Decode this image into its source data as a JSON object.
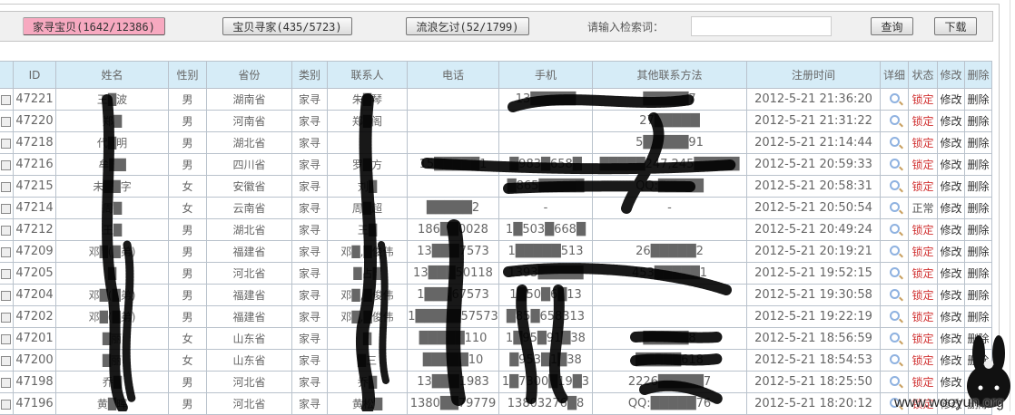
{
  "toolbar": {
    "tabs": [
      {
        "label": "家寻宝贝(1642/12386)",
        "active": true
      },
      {
        "label": "宝贝寻家(435/5723)",
        "active": false
      },
      {
        "label": "流浪乞讨(52/1799)",
        "active": false
      }
    ],
    "search_label": "请输入检索词：",
    "search_value": "",
    "query_label": "查询",
    "download_label": "下载"
  },
  "table": {
    "headers": [
      "ID",
      "姓名",
      "性别",
      "省份",
      "类别",
      "联系人",
      "电话",
      "手机",
      "其他联系方法",
      "注册时间",
      "详细",
      "状态",
      "修改",
      "删除"
    ],
    "rows": [
      {
        "id": "47221",
        "name": "王█波",
        "gender": "男",
        "province": "湖南省",
        "type": "家寻",
        "contact": "朱█琴",
        "phone": "",
        "mobile": "13█████",
        "other": "█████7",
        "time": "2012-5-21 21:36:20",
        "status": "锁定"
      },
      {
        "id": "47220",
        "name": "郑█",
        "gender": "男",
        "province": "河南省",
        "type": "家寻",
        "contact": "郑█阁",
        "phone": "",
        "mobile": "",
        "other": "27█████",
        "time": "2012-5-21 21:31:22",
        "status": "锁定"
      },
      {
        "id": "47218",
        "name": "代█明",
        "gender": "男",
        "province": "湖北省",
        "type": "家寻",
        "contact": "",
        "phone": "",
        "mobile": "",
        "other": "5█████91",
        "time": "2012-5-21 21:14:44",
        "status": "锁定"
      },
      {
        "id": "47216",
        "name": "牟██",
        "gender": "男",
        "province": "四川省",
        "type": "家寻",
        "contact": "罗█方",
        "phone": "15█████1",
        "mobile": "█983█658█",
        "other": "█████247,245█████",
        "time": "2012-5-21 20:59:33",
        "status": "锁定"
      },
      {
        "id": "47215",
        "name": "未██字",
        "gender": "女",
        "province": "安徽省",
        "type": "家寻",
        "contact": "刘█",
        "phone": "",
        "mobile": "█865█████",
        "other": "QQ:█████",
        "time": "2012-5-21 20:58:31",
        "status": "锁定"
      },
      {
        "id": "47214",
        "name": "周█",
        "gender": "女",
        "province": "云南省",
        "type": "家寻",
        "contact": "周█超",
        "phone": "█████2",
        "mobile": "-",
        "other": "-",
        "time": "2012-5-21 20:50:54",
        "status": "正常"
      },
      {
        "id": "47212",
        "name": "王█",
        "gender": "男",
        "province": "湖北省",
        "type": "家寻",
        "contact": "王█",
        "phone": "186██0028",
        "mobile": "1█503█668█",
        "other": "",
        "time": "2012-5-21 20:49:24",
        "status": "锁定"
      },
      {
        "id": "47209",
        "name": "邓█(█弟)",
        "gender": "男",
        "province": "福建省",
        "type": "家寻",
        "contact": "邓█,█俊伟",
        "phone": "13███7573",
        "mobile": "1█████513",
        "other": "26█████2",
        "time": "2012-5-21 20:19:21",
        "status": "锁定"
      },
      {
        "id": "47205",
        "name": "█",
        "gender": "男",
        "province": "河北省",
        "type": "家寻",
        "contact": "█占█",
        "phone": "13███50118",
        "mobile": "1393█████",
        "other": "453█████1",
        "time": "2012-5-21 19:52:15",
        "status": "锁定"
      },
      {
        "id": "47204",
        "name": "邓█(█弟)",
        "gender": "男",
        "province": "福建省",
        "type": "家寻",
        "contact": "邓█,█俊伟",
        "phone": "1███67573",
        "mobile": "1█50█6█13",
        "other": "",
        "time": "2012-5-21 19:30:58",
        "status": "锁定"
      },
      {
        "id": "47202",
        "name": "邓█(█弟)",
        "gender": "男",
        "province": "福建省",
        "type": "家寻",
        "contact": "邓█,█俊伟",
        "phone": "1█████57573",
        "mobile": "█85█658313",
        "other": "",
        "time": "2012-5-21 19:22:19",
        "status": "锁定"
      },
      {
        "id": "47201",
        "name": "█丽",
        "gender": "女",
        "province": "山东省",
        "type": "家寻",
        "contact": "█",
        "phone": "█████110",
        "mobile": "1█95█91█38",
        "other": "█████8",
        "time": "2012-5-21 18:56:59",
        "status": "锁定"
      },
      {
        "id": "47200",
        "name": "█丽",
        "gender": "女",
        "province": "山东省",
        "type": "家寻",
        "contact": "█三",
        "phone": "█████10",
        "mobile": "█953█1█38",
        "other": "█████618",
        "time": "2012-5-21 18:54:53",
        "status": "锁定"
      },
      {
        "id": "47198",
        "name": "乔█",
        "gender": "男",
        "province": "河北省",
        "type": "家寻",
        "contact": "乔█",
        "phone": "13███1983",
        "mobile": "1█7300█19█3",
        "other": "2226█████7",
        "time": "2012-5-21 18:25:50",
        "status": "锁定"
      },
      {
        "id": "47196",
        "name": "黄█晖",
        "gender": "男",
        "province": "河北省",
        "type": "家寻",
        "contact": "黄松█",
        "phone": "1380██79779",
        "mobile": "13803276█8",
        "other": "QQ:█████76",
        "time": "2012-5-21 18:20:12",
        "status": "锁定"
      }
    ],
    "edit_label": "修改",
    "delete_label": "删除"
  },
  "watermark": "www.wooyun.org",
  "colors": {
    "active_tab": "#f7a9c0",
    "header_bg": "#d6ecf7",
    "locked": "#d03030"
  }
}
